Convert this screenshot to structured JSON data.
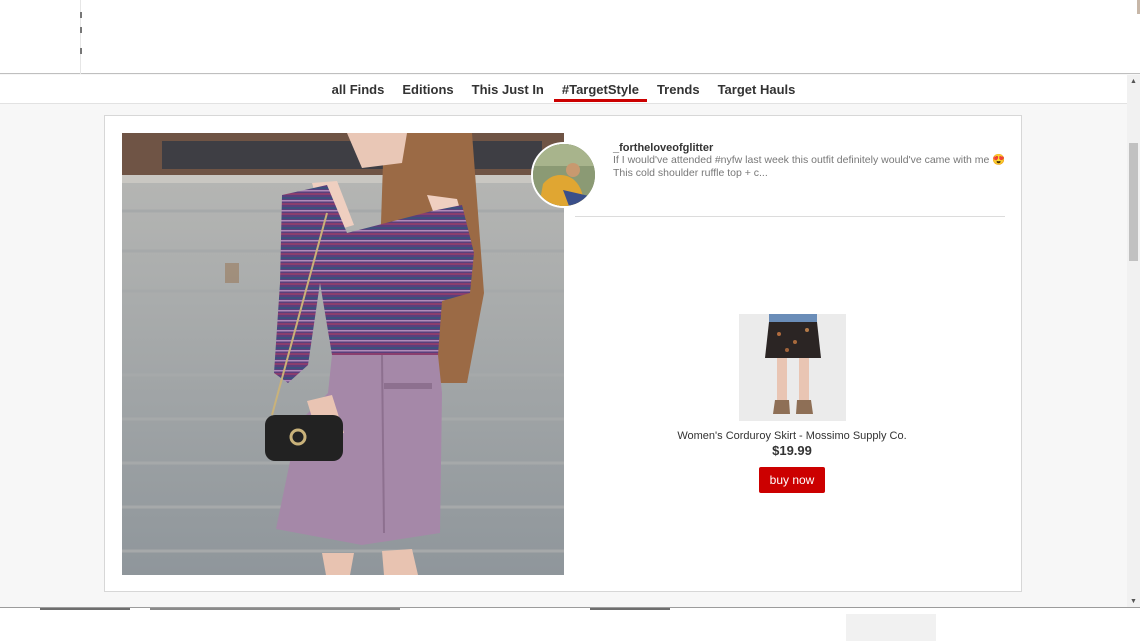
{
  "nav": {
    "tabs": [
      {
        "label": "all Finds",
        "active": false
      },
      {
        "label": "Editions",
        "active": false
      },
      {
        "label": "This Just In",
        "active": false
      },
      {
        "label": "#TargetStyle",
        "active": true
      },
      {
        "label": "Trends",
        "active": false
      },
      {
        "label": "Target Hauls",
        "active": false
      }
    ]
  },
  "post": {
    "username": "_fortheloveofglitter",
    "caption": "If I would've attended #nyfw last week this outfit definitely would've came with me 😍 This cold shoulder ruffle top + c..."
  },
  "product": {
    "name": "Women's Corduroy Skirt - Mossimo Supply Co.",
    "price": "$19.99",
    "buy_label": "buy now"
  },
  "colors": {
    "accent": "#cc0000",
    "nav_text": "#333333",
    "caption_text": "#777777"
  }
}
